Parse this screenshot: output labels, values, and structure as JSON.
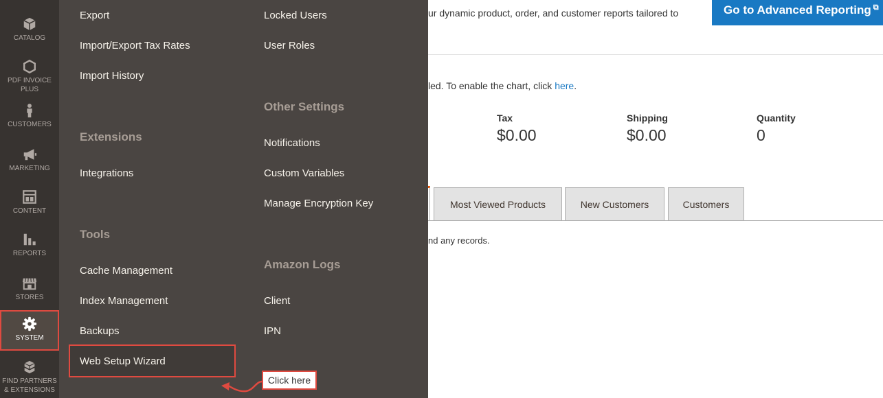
{
  "sidebar": {
    "items": [
      {
        "key": "catalog",
        "label": "CATALOG",
        "icon": "cube-icon"
      },
      {
        "key": "pdf",
        "label": "PDF INVOICE PLUS",
        "icon": "hexagon-icon"
      },
      {
        "key": "customers",
        "label": "CUSTOMERS",
        "icon": "person-icon"
      },
      {
        "key": "marketing",
        "label": "MARKETING",
        "icon": "megaphone-icon"
      },
      {
        "key": "content",
        "label": "CONTENT",
        "icon": "layout-icon"
      },
      {
        "key": "reports",
        "label": "REPORTS",
        "icon": "bar-chart-icon"
      },
      {
        "key": "stores",
        "label": "STORES",
        "icon": "storefront-icon"
      },
      {
        "key": "system",
        "label": "SYSTEM",
        "icon": "gear-icon",
        "active": true
      },
      {
        "key": "partners",
        "label": "FIND PARTNERS & EXTENSIONS",
        "icon": "boxes-icon"
      }
    ]
  },
  "flyout": {
    "col1": {
      "export": "Export",
      "import_export_tax": "Import/Export Tax Rates",
      "import_history": "Import History",
      "extensions_title": "Extensions",
      "integrations": "Integrations",
      "tools_title": "Tools",
      "cache_management": "Cache Management",
      "index_management": "Index Management",
      "backups": "Backups",
      "web_setup_wizard": "Web Setup Wizard"
    },
    "col2": {
      "locked_users": "Locked Users",
      "user_roles": "User Roles",
      "other_settings_title": "Other Settings",
      "notifications": "Notifications",
      "custom_variables": "Custom Variables",
      "manage_encryption_key": "Manage Encryption Key",
      "amazon_logs_title": "Amazon Logs",
      "client": "Client",
      "ipn": "IPN"
    }
  },
  "dashboard": {
    "intro_text": "ur dynamic product, order, and customer reports tailored to",
    "advanced_reporting_label": "Go to Advanced Reporting",
    "external_icon_glyph": "⧉",
    "chart_notice_prefix": "led. To enable the chart, click ",
    "chart_notice_link": "here",
    "chart_notice_suffix": ".",
    "stats": [
      {
        "label": "Tax",
        "value": "$0.00"
      },
      {
        "label": "Shipping",
        "value": "$0.00"
      },
      {
        "label": "Quantity",
        "value": "0"
      }
    ],
    "tabs": [
      "Most Viewed Products",
      "New Customers",
      "Customers"
    ],
    "no_records_text": "nd any records."
  },
  "annotation": {
    "callout_text": "Click here",
    "highlight_color": "#e04a40"
  }
}
